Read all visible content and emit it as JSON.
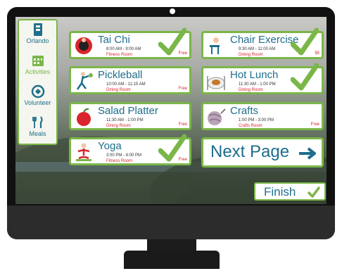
{
  "sidebar": {
    "items": [
      {
        "label": "Orlando",
        "icon": "building-icon"
      },
      {
        "label": "Activities",
        "icon": "calendar-icon"
      },
      {
        "label": "Volunteer",
        "icon": "compass-icon"
      },
      {
        "label": "Meals",
        "icon": "fork-knife-icon"
      }
    ]
  },
  "activities": [
    {
      "title": "Tai Chi",
      "time": "8:00 AM - 9:00 AM",
      "room": "Fitness Room",
      "price": "Free",
      "selected": true,
      "icon": "tai-chi-icon"
    },
    {
      "title": "Chair Exercise",
      "time": "9:30 AM - 11:00 AM",
      "room": "Dining Room",
      "price": "$5",
      "selected": true,
      "icon": "chair-exercise-icon"
    },
    {
      "title": "Pickleball",
      "time": "10:00 AM - 11:15 AM",
      "room": "Dining Room",
      "price": "Free",
      "selected": false,
      "icon": "pickleball-icon"
    },
    {
      "title": "Hot Lunch",
      "time": "11:30 AM - 1:00 PM",
      "room": "Dining Room",
      "price": "",
      "selected": true,
      "icon": "plate-icon"
    },
    {
      "title": "Salad Platter",
      "time": "11:30 AM - 1:00 PM",
      "room": "Dining Room",
      "price": "Free",
      "selected": false,
      "icon": "apple-icon"
    },
    {
      "title": "Crafts",
      "time": "1:00 PM - 3:00 PM",
      "room": "Crafts Room",
      "price": "Free",
      "selected": false,
      "icon": "yarn-icon"
    },
    {
      "title": "Yoga",
      "time": "3:00 PM - 4:00 PM",
      "room": "Fitness Room",
      "price": "Free",
      "selected": true,
      "icon": "yoga-icon"
    }
  ],
  "next_page": {
    "label": "Next Page",
    "icon": "arrow-right-icon"
  },
  "finish": {
    "label": "Finish",
    "icon": "check-icon"
  },
  "colors": {
    "accent_green": "#7ab648",
    "title_blue": "#1e6e8c",
    "room_red": "#d9252b"
  }
}
